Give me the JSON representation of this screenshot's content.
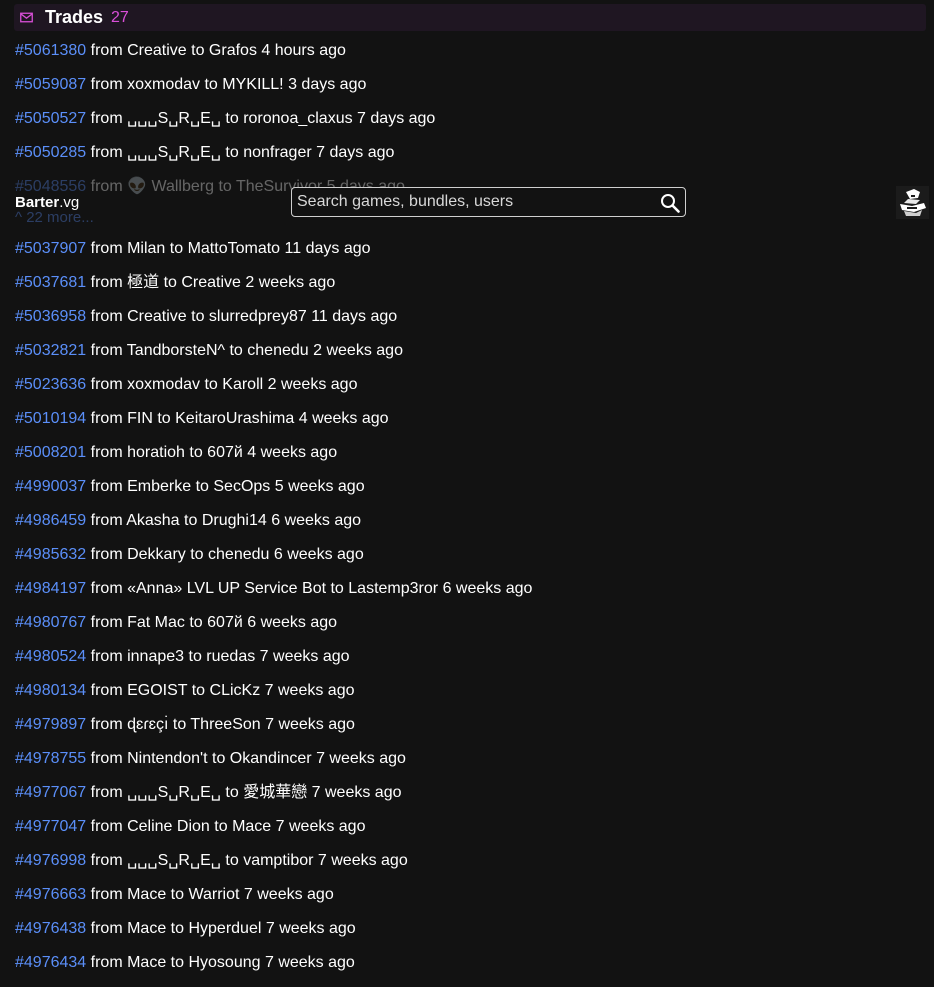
{
  "header": {
    "title": "Trades",
    "count": "27",
    "icon": "mail-icon"
  },
  "nav": {
    "brand_bold": "Barter",
    "brand_rest": ".vg",
    "search_placeholder": "Search games, bundles, users",
    "more_text": "^ 22 more..."
  },
  "trades": [
    {
      "id": "#5061380",
      "from": "Creative",
      "to": "Grafos",
      "when": "4 hours ago"
    },
    {
      "id": "#5059087",
      "from": "xoxmodav",
      "to": "MYKILL!",
      "when": "3 days ago"
    },
    {
      "id": "#5050527",
      "from": "␣␣␣S␣R␣E␣",
      "to": "roronoa_claxus",
      "when": "7 days ago"
    },
    {
      "id": "#5050285",
      "from": "␣␣␣S␣R␣E␣",
      "to": "nonfrager",
      "when": "7 days ago"
    },
    {
      "id": "#5048556",
      "from": "👽 Wallberg",
      "to": "TheSurvivor",
      "when": "5 days ago"
    },
    {
      "id": "#5037907",
      "from": "Milan",
      "to": "MattoTomato",
      "when": "11 days ago"
    },
    {
      "id": "#5037681",
      "from": "極道",
      "to": "Creative",
      "when": "2 weeks ago"
    },
    {
      "id": "#5036958",
      "from": "Creative",
      "to": "slurredprey87",
      "when": "11 days ago"
    },
    {
      "id": "#5032821",
      "from": "TandborsteN^",
      "to": "chenedu",
      "when": "2 weeks ago"
    },
    {
      "id": "#5023636",
      "from": "xoxmodav",
      "to": "Karoll",
      "when": "2 weeks ago"
    },
    {
      "id": "#5010194",
      "from": "FIN",
      "to": "KeitaroUrashima",
      "when": "4 weeks ago"
    },
    {
      "id": "#5008201",
      "from": "horatioh",
      "to": "607й",
      "when": "4 weeks ago"
    },
    {
      "id": "#4990037",
      "from": "Emberke",
      "to": "SecOps",
      "when": "5 weeks ago"
    },
    {
      "id": "#4986459",
      "from": "Akasha",
      "to": "Drughi14",
      "when": "6 weeks ago"
    },
    {
      "id": "#4985632",
      "from": "Dekkary",
      "to": "chenedu",
      "when": "6 weeks ago"
    },
    {
      "id": "#4984197",
      "from": "«Anna» LVL UP Service Bot",
      "to": "Lastemp3ror",
      "when": "6 weeks ago"
    },
    {
      "id": "#4980767",
      "from": "Fat Mac",
      "to": "607й",
      "when": "6 weeks ago"
    },
    {
      "id": "#4980524",
      "from": "innape3",
      "to": "ruedas",
      "when": "7 weeks ago"
    },
    {
      "id": "#4980134",
      "from": "EGOIST",
      "to": "CLicKz",
      "when": "7 weeks ago"
    },
    {
      "id": "#4979897",
      "from": "ɖɛɾɛçı̇",
      "to": "ThreeSon",
      "when": "7 weeks ago"
    },
    {
      "id": "#4978755",
      "from": "Nintendon't",
      "to": "Okandincer",
      "when": "7 weeks ago"
    },
    {
      "id": "#4977067",
      "from": "␣␣␣S␣R␣E␣",
      "to": "愛城華戀",
      "when": "7 weeks ago"
    },
    {
      "id": "#4977047",
      "from": "Celine Dion",
      "to": "Mace",
      "when": "7 weeks ago"
    },
    {
      "id": "#4976998",
      "from": "␣␣␣S␣R␣E␣",
      "to": "vamptibor",
      "when": "7 weeks ago"
    },
    {
      "id": "#4976663",
      "from": "Mace",
      "to": "Warriot",
      "when": "7 weeks ago"
    },
    {
      "id": "#4976438",
      "from": "Mace",
      "to": "Hyperduel",
      "when": "7 weeks ago"
    },
    {
      "id": "#4976434",
      "from": "Mace",
      "to": "Hyosoung",
      "when": "7 weeks ago"
    }
  ],
  "words": {
    "from": "from",
    "to": "to"
  },
  "colors": {
    "accent_pink": "#d94fd8",
    "link_blue": "#5b8ff9",
    "background": "#121212"
  }
}
